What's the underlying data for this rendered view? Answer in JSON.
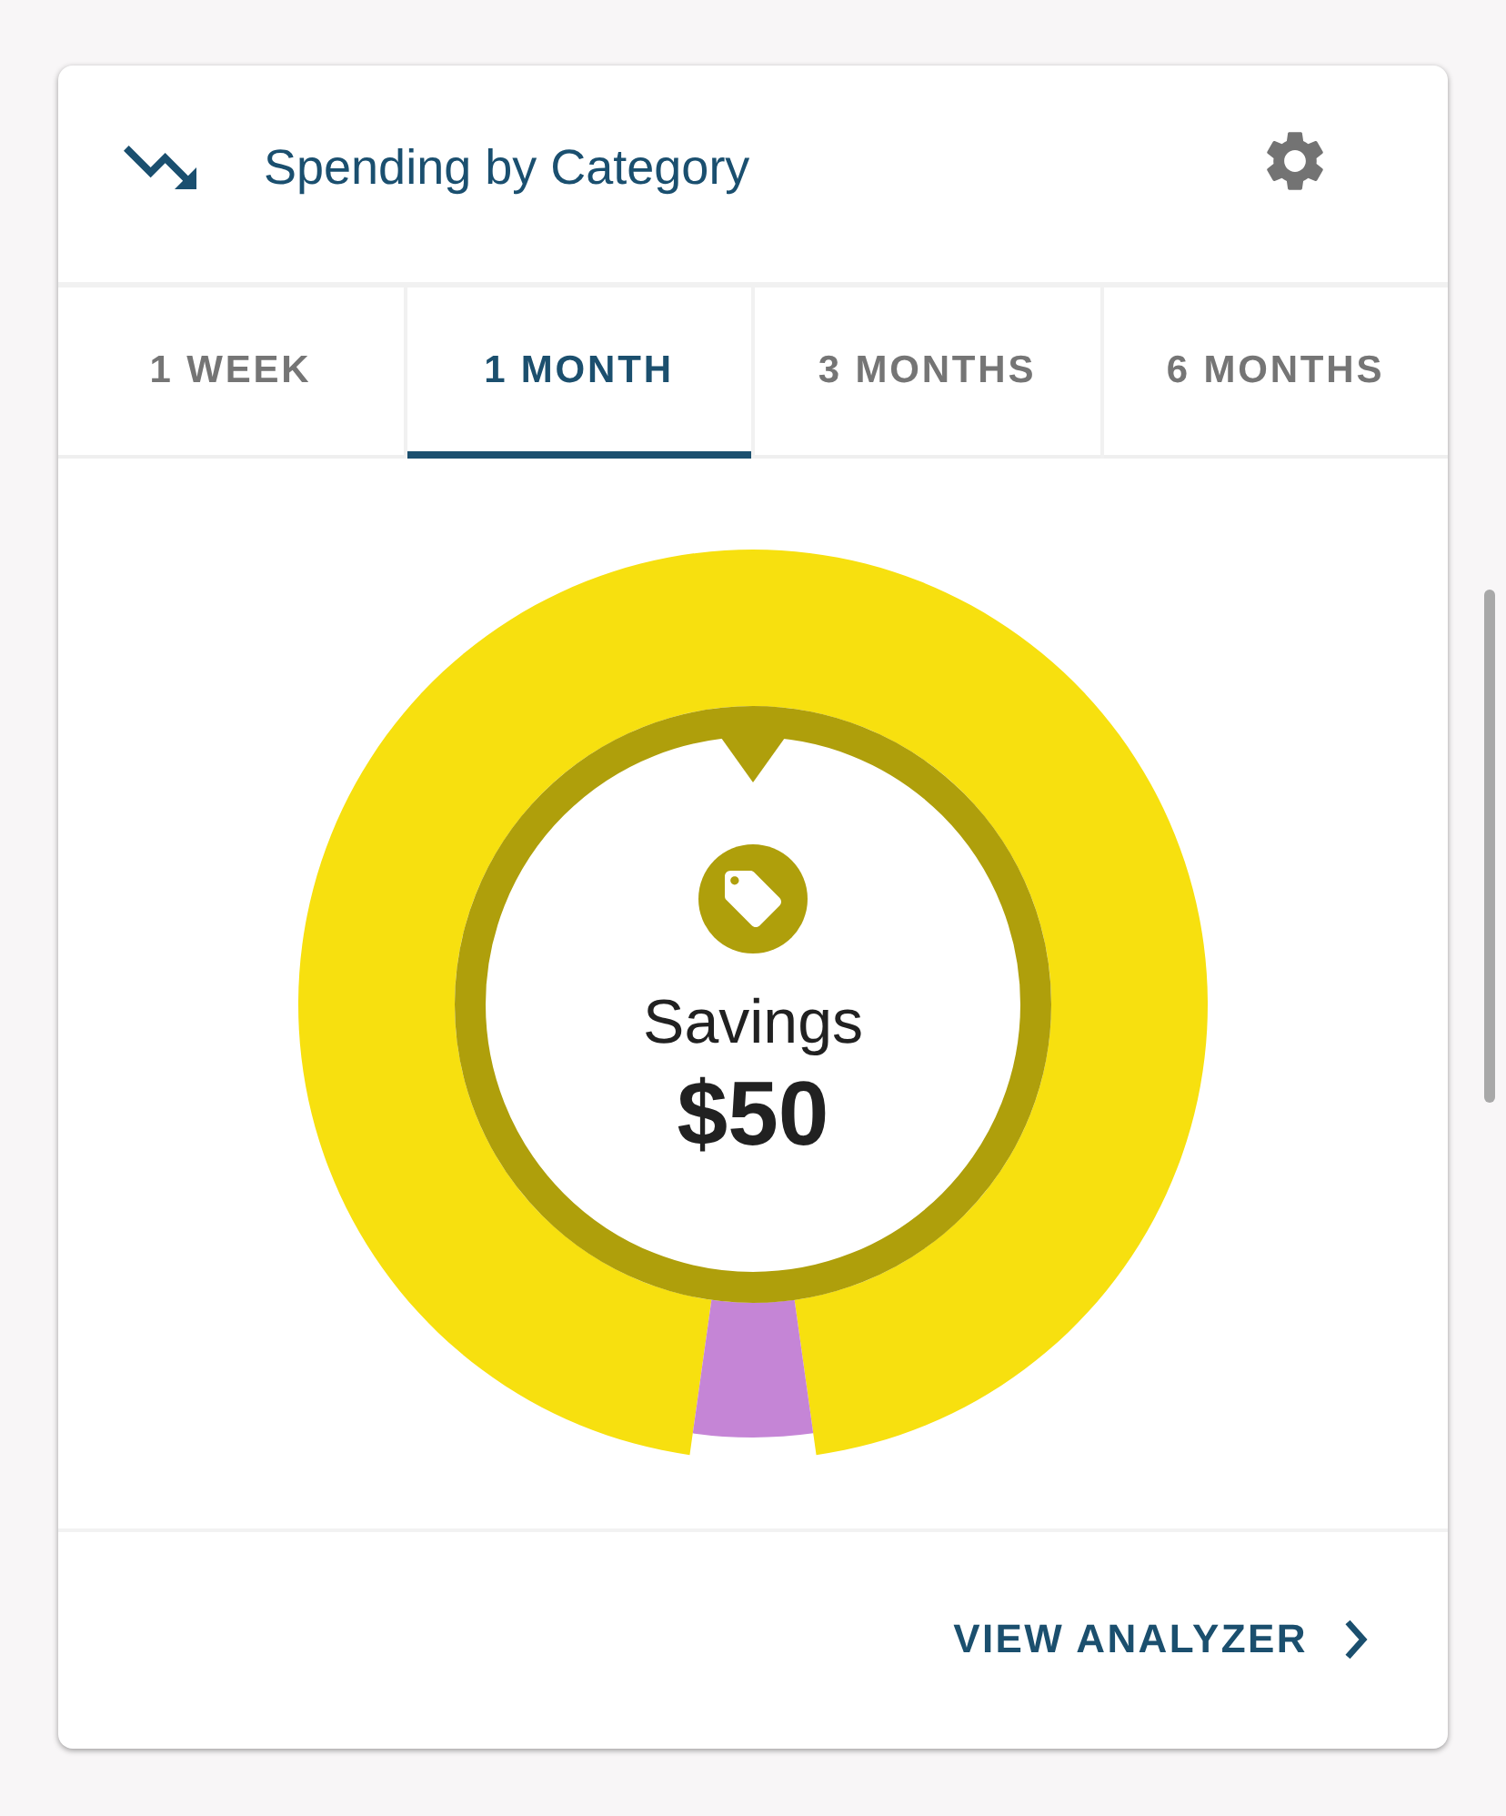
{
  "header": {
    "title": "Spending by Category"
  },
  "tabs": [
    {
      "label": "1 WEEK",
      "selected": false
    },
    {
      "label": "1 MONTH",
      "selected": true
    },
    {
      "label": "3 MONTHS",
      "selected": false
    },
    {
      "label": "6 MONTHS",
      "selected": false
    }
  ],
  "donut": {
    "segments": [
      {
        "color": "#f7e00f",
        "selected": true
      },
      {
        "color": "#c585d6",
        "selected": false
      }
    ],
    "center": {
      "label": "Savings",
      "amount": "$50"
    }
  },
  "footer": {
    "link": "VIEW ANALYZER"
  }
}
